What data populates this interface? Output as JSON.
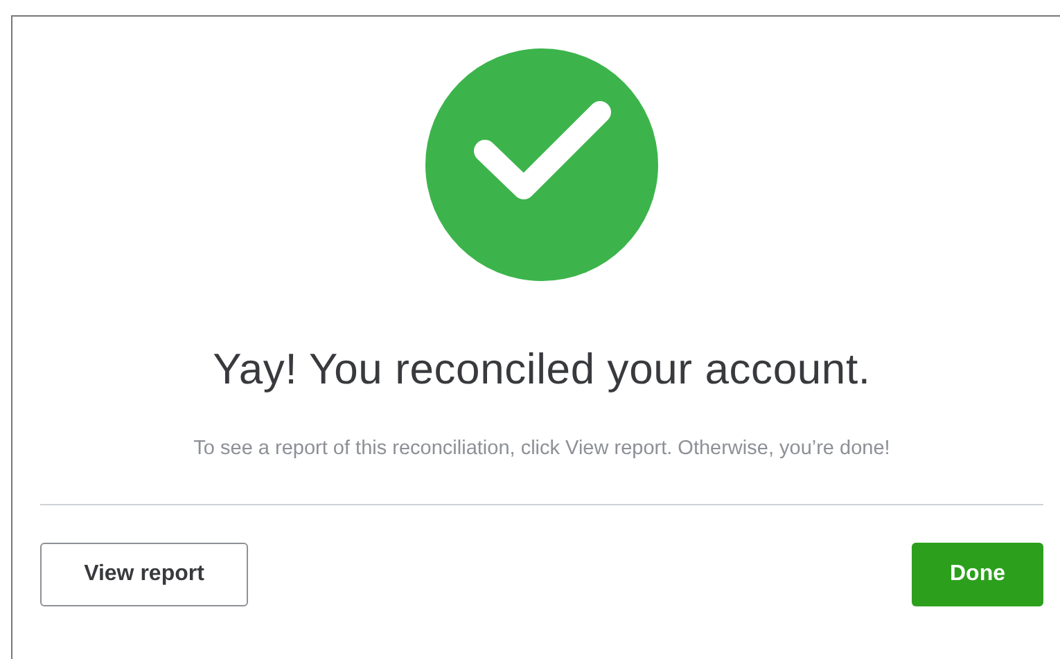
{
  "title": "Yay! You reconciled your account.",
  "message": "To see a report of this reconciliation, click View report. Otherwise, you’re done!",
  "buttons": [
    {
      "label": "View report",
      "kind": "secondary"
    },
    {
      "label": "Done",
      "kind": "primary"
    }
  ]
}
